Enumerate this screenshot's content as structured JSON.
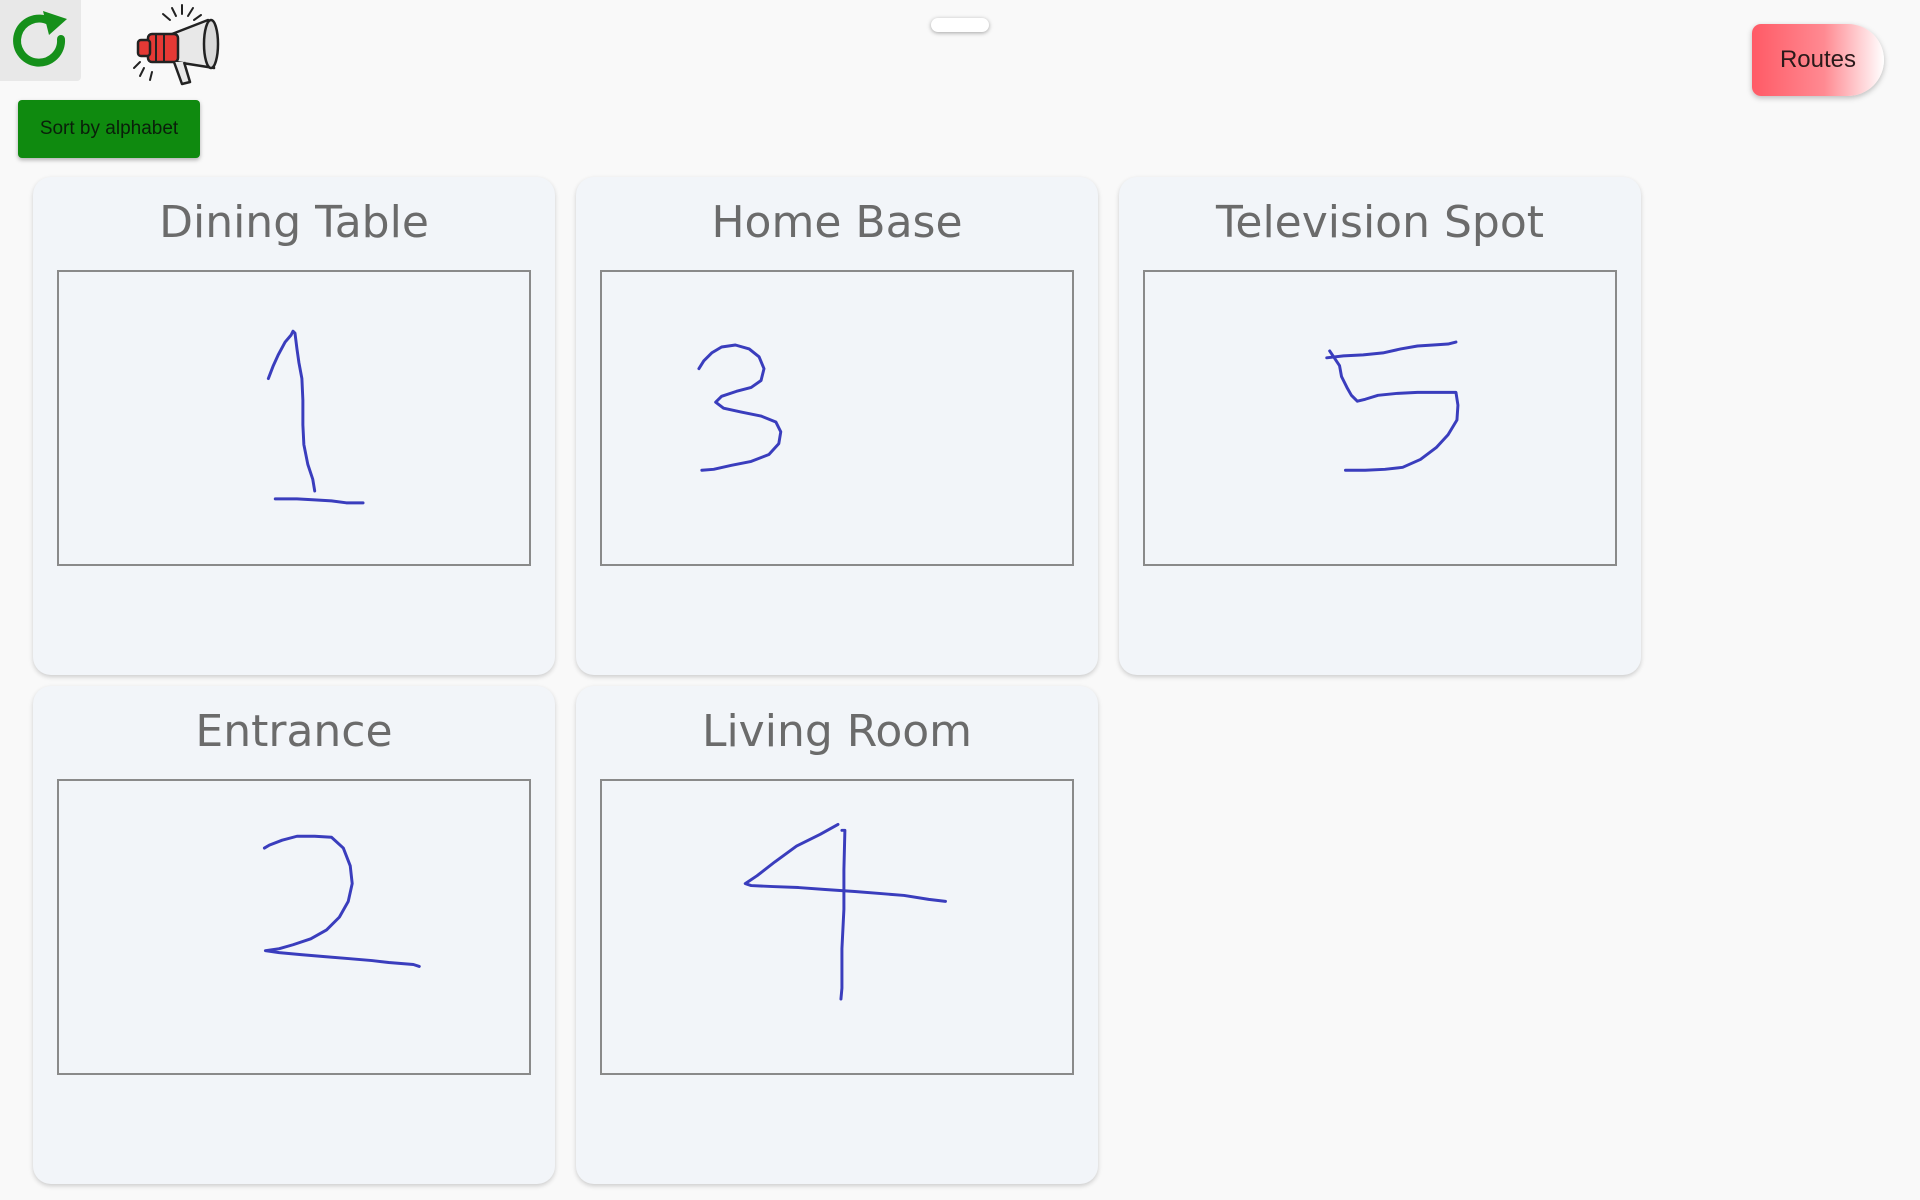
{
  "toolbar": {
    "refresh_icon": "refresh-icon",
    "announce_icon": "megaphone-icon",
    "sort_label": "Sort by alphabet",
    "routes_label": "Routes",
    "accent_green": "#0f8a0f",
    "routes_color": "#ff5a66"
  },
  "locations": [
    {
      "name": "Dining Table",
      "drawing": "digit-1"
    },
    {
      "name": "Home Base",
      "drawing": "digit-3"
    },
    {
      "name": "Television Spot",
      "drawing": "digit-5"
    },
    {
      "name": "Entrance",
      "drawing": "digit-2"
    },
    {
      "name": "Living Room",
      "drawing": "digit-4"
    }
  ]
}
